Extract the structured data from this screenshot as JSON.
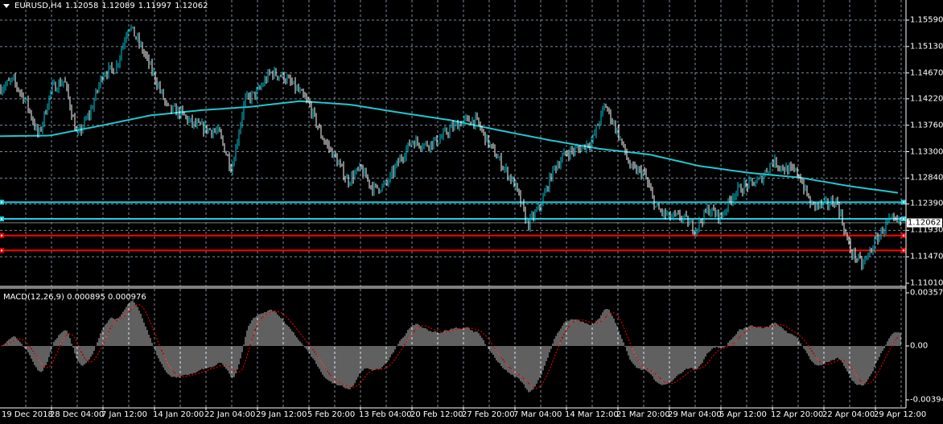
{
  "header": {
    "symbol": "EURUSD,H4",
    "open": "1.12058",
    "high": "1.12089",
    "low": "1.11997",
    "close": "1.12062"
  },
  "macd_header": {
    "name": "MACD(12,26,9)",
    "macd": "0.000895",
    "signal": "0.000976"
  },
  "current_price_label": "1.12062",
  "colors": {
    "bull": "#00c8d8",
    "bear": "#ffffff",
    "ma": "#20c8d0",
    "hline_cyan": "#20d0e0",
    "hline_red": "#ff0000",
    "grid": "#7a8a9a",
    "hist": "#c0c0c0",
    "signal": "#ff0000"
  },
  "chart_data": {
    "type": "candlestick",
    "symbol": "EURUSD",
    "timeframe": "H4",
    "price_axis": {
      "labels": [
        "1.15590",
        "1.15130",
        "1.14670",
        "1.14220",
        "1.13760",
        "1.13300",
        "1.12840",
        "1.12390",
        "1.11930",
        "1.11470",
        "1.11010"
      ],
      "range": [
        1.1101,
        1.1559
      ]
    },
    "macd_axis": {
      "labels": [
        "0.003571",
        "0.00",
        "-0.003947"
      ],
      "range": [
        -0.003947,
        0.003571
      ]
    },
    "date_labels": [
      "19 Dec 2018",
      "28 Dec 04:00",
      "7 Jan 12:00",
      "14 Jan 20:00",
      "22 Jan 04:00",
      "29 Jan 12:00",
      "5 Feb 20:00",
      "13 Feb 04:00",
      "20 Feb 12:00",
      "27 Feb 20:00",
      "7 Mar 04:00",
      "14 Mar 12:00",
      "21 Mar 20:00",
      "29 Mar 04:00",
      "5 Apr 12:00",
      "12 Apr 20:00",
      "22 Apr 04:00",
      "29 Apr 12:00"
    ],
    "close_anchors": [
      1.144,
      1.1454,
      1.1419,
      1.1356,
      1.144,
      1.1454,
      1.1356,
      1.1398,
      1.1468,
      1.1475,
      1.1552,
      1.151,
      1.1461,
      1.1405,
      1.1398,
      1.1377,
      1.137,
      1.1363,
      1.13,
      1.1419,
      1.1433,
      1.1468,
      1.1461,
      1.144,
      1.1412,
      1.1356,
      1.1321,
      1.1279,
      1.13,
      1.1265,
      1.1272,
      1.1314,
      1.1349,
      1.1342,
      1.1349,
      1.137,
      1.1384,
      1.1384,
      1.1342,
      1.1307,
      1.1272,
      1.1202,
      1.1237,
      1.13,
      1.1328,
      1.1335,
      1.1349,
      1.1412,
      1.1363,
      1.13,
      1.1293,
      1.123,
      1.1216,
      1.1216,
      1.1195,
      1.123,
      1.1216,
      1.1258,
      1.1272,
      1.1279,
      1.1314,
      1.13,
      1.1293,
      1.1237,
      1.1237,
      1.1244,
      1.116,
      1.1132,
      1.1174,
      1.1209,
      1.1206
    ],
    "moving_average_anchors": [
      1.1357,
      1.1358,
      1.1375,
      1.1393,
      1.1402,
      1.1408,
      1.1418,
      1.1412,
      1.1398,
      1.1385,
      1.1367,
      1.135,
      1.1335,
      1.1325,
      1.1305,
      1.1293,
      1.1285,
      1.127,
      1.1258
    ],
    "horizontal_levels": [
      {
        "price": 1.1242,
        "color": "cyan"
      },
      {
        "price": 1.1213,
        "color": "cyan"
      },
      {
        "price": 1.1184,
        "color": "red"
      },
      {
        "price": 1.1158,
        "color": "red"
      }
    ],
    "last_price": 1.12062
  }
}
